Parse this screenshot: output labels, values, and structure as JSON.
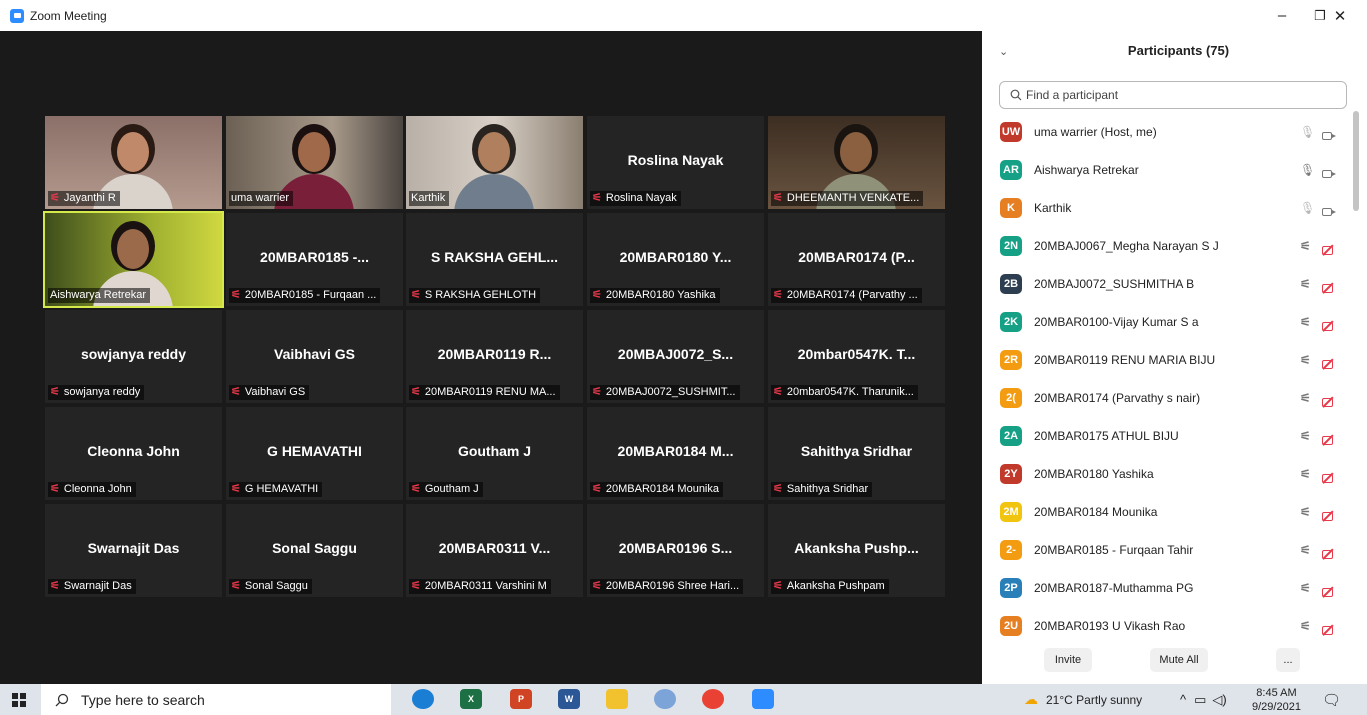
{
  "window": {
    "title": "Zoom Meeting",
    "minimize": "–",
    "restore": "❐",
    "close": "✕"
  },
  "tiles": [
    {
      "name": "",
      "label": "Jayanthi R",
      "mic_off": true,
      "video": "jayanthi"
    },
    {
      "name": "",
      "label": "uma warrier",
      "mic_off": false,
      "video": "uma"
    },
    {
      "name": "",
      "label": "Karthik",
      "mic_off": false,
      "video": "karthik"
    },
    {
      "name": "Roslina Nayak",
      "label": "Roslina Nayak",
      "mic_off": true
    },
    {
      "name": "",
      "label": "DHEEMANTH VENKATE...",
      "mic_off": true,
      "video": "dheemanth"
    },
    {
      "name": "",
      "label": "Aishwarya Retrekar",
      "mic_off": false,
      "video": "aishwarya",
      "active": true
    },
    {
      "name": "20MBAR0185 -...",
      "label": "20MBAR0185 - Furqaan ...",
      "mic_off": true
    },
    {
      "name": "S RAKSHA GEHL...",
      "label": "S RAKSHA GEHLOTH",
      "mic_off": true
    },
    {
      "name": "20MBAR0180 Y...",
      "label": "20MBAR0180 Yashika",
      "mic_off": true
    },
    {
      "name": "20MBAR0174 (P...",
      "label": "20MBAR0174 (Parvathy ...",
      "mic_off": true
    },
    {
      "name": "sowjanya reddy",
      "label": "sowjanya reddy",
      "mic_off": true
    },
    {
      "name": "Vaibhavi GS",
      "label": "Vaibhavi GS",
      "mic_off": true
    },
    {
      "name": "20MBAR0119 R...",
      "label": "20MBAR0119 RENU MA...",
      "mic_off": true
    },
    {
      "name": "20MBAJ0072_S...",
      "label": "20MBAJ0072_SUSHMIT...",
      "mic_off": true
    },
    {
      "name": "20mbar0547K. T...",
      "label": "20mbar0547K. Tharunik...",
      "mic_off": true
    },
    {
      "name": "Cleonna John",
      "label": "Cleonna John",
      "mic_off": true
    },
    {
      "name": "G HEMAVATHI",
      "label": "G HEMAVATHI",
      "mic_off": true
    },
    {
      "name": "Goutham J",
      "label": "Goutham J",
      "mic_off": true
    },
    {
      "name": "20MBAR0184 M...",
      "label": "20MBAR0184 Mounika",
      "mic_off": true
    },
    {
      "name": "Sahithya Sridhar",
      "label": "Sahithya Sridhar",
      "mic_off": true
    },
    {
      "name": "Swarnajit Das",
      "label": "Swarnajit Das",
      "mic_off": true
    },
    {
      "name": "Sonal Saggu",
      "label": "Sonal Saggu",
      "mic_off": true
    },
    {
      "name": "20MBAR0311 V...",
      "label": "20MBAR0311 Varshini M",
      "mic_off": true
    },
    {
      "name": "20MBAR0196 S...",
      "label": "20MBAR0196 Shree Hari...",
      "mic_off": true
    },
    {
      "name": "Akanksha  Pushp...",
      "label": "Akanksha Pushpam",
      "mic_off": true
    }
  ],
  "participants_panel": {
    "collapse_icon": "⌄",
    "title": "Participants (75)",
    "search_placeholder": "Find a participant",
    "items": [
      {
        "initials": "UW",
        "color": "#c0392b",
        "name": "uma warrier (Host, me)",
        "mic": "on-gray",
        "cam": "on"
      },
      {
        "initials": "AR",
        "color": "#16a085",
        "name": "Aishwarya Retrekar",
        "mic": "on-dark",
        "cam": "on"
      },
      {
        "initials": "K",
        "color": "#e67e22",
        "name": "Karthik",
        "mic": "on-gray",
        "cam": "on"
      },
      {
        "initials": "2N",
        "color": "#16a085",
        "name": "20MBAJ0067_Megha Narayan S J",
        "mic": "off",
        "cam": "off"
      },
      {
        "initials": "2B",
        "color": "#2c3e50",
        "name": "20MBAJ0072_SUSHMITHA B",
        "mic": "off",
        "cam": "off"
      },
      {
        "initials": "2K",
        "color": "#16a085",
        "name": "20MBAR0100-Vijay Kumar S a",
        "mic": "off",
        "cam": "off"
      },
      {
        "initials": "2R",
        "color": "#f39c12",
        "name": "20MBAR0119 RENU MARIA BIJU",
        "mic": "off",
        "cam": "off"
      },
      {
        "initials": "2(",
        "color": "#f39c12",
        "name": "20MBAR0174 (Parvathy s nair)",
        "mic": "off",
        "cam": "off"
      },
      {
        "initials": "2A",
        "color": "#16a085",
        "name": "20MBAR0175 ATHUL BIJU",
        "mic": "off",
        "cam": "off"
      },
      {
        "initials": "2Y",
        "color": "#c0392b",
        "name": "20MBAR0180 Yashika",
        "mic": "off",
        "cam": "off"
      },
      {
        "initials": "2M",
        "color": "#f1c40f",
        "name": "20MBAR0184 Mounika",
        "mic": "off",
        "cam": "off"
      },
      {
        "initials": "2-",
        "color": "#f39c12",
        "name": "20MBAR0185 - Furqaan Tahir",
        "mic": "off",
        "cam": "off"
      },
      {
        "initials": "2P",
        "color": "#2980b9",
        "name": "20MBAR0187-Muthamma PG",
        "mic": "off",
        "cam": "off"
      },
      {
        "initials": "2U",
        "color": "#e67e22",
        "name": "20MBAR0193 U Vikash Rao",
        "mic": "off",
        "cam": "off"
      }
    ],
    "invite_label": "Invite",
    "mute_all_label": "Mute All",
    "more_label": "..."
  },
  "taskbar": {
    "search_placeholder": "Type here to search",
    "weather": "21°C  Partly sunny",
    "time": "8:45 AM",
    "date": "9/29/2021"
  }
}
